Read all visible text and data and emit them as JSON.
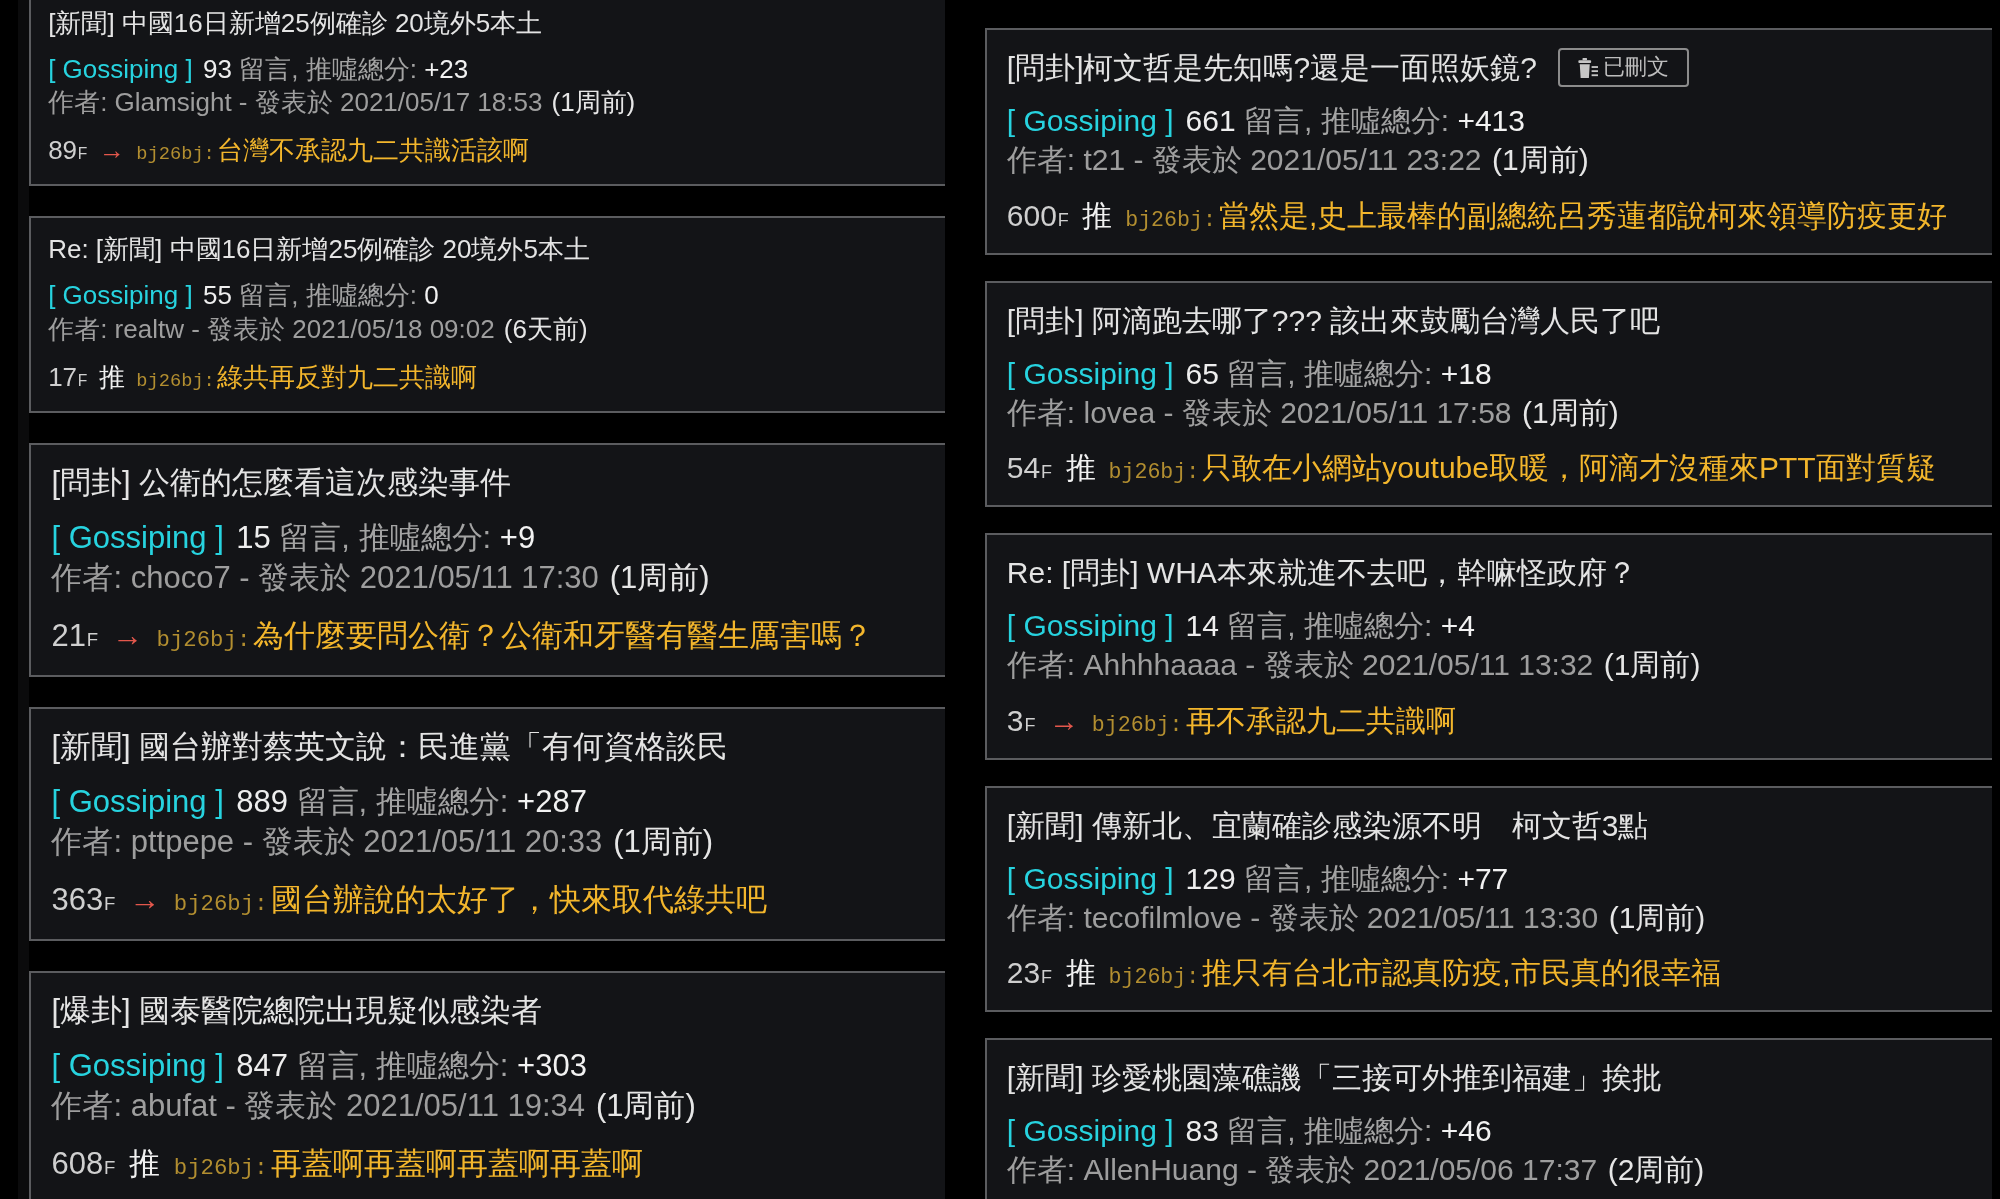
{
  "columns": [
    {
      "posts": [
        {
          "title": "[新聞] 中國16日新增25例確診 20境外5本土",
          "board": "[ Gossiping ]",
          "comments": "93",
          "stats_label": "留言, 推噓總分:",
          "score": "+23",
          "author_line": "作者: Glamsight - 發表於 2021/05/17 18:53",
          "age": "(1周前)",
          "top_comment": {
            "floor": "89",
            "floor_suffix": "F",
            "kind": "arrow",
            "tag": "→",
            "user": "bj26bj:",
            "text": "台灣不承認九二共識活該啊"
          }
        },
        {
          "title": "Re: [新聞] 中國16日新增25例確診 20境外5本土",
          "board": "[ Gossiping ]",
          "comments": "55",
          "stats_label": "留言, 推噓總分:",
          "score": "0",
          "author_line": "作者: realtw - 發表於 2021/05/18 09:02",
          "age": "(6天前)",
          "top_comment": {
            "floor": "17",
            "floor_suffix": "F",
            "kind": "push",
            "tag": "推",
            "user": "bj26bj:",
            "text": "綠共再反對九二共識啊"
          }
        },
        {
          "title": "[問卦] 公衛的怎麼看這次感染事件",
          "board": "[ Gossiping ]",
          "comments": "15",
          "stats_label": "留言, 推噓總分:",
          "score": "+9",
          "author_line": "作者: choco7 - 發表於 2021/05/11 17:30",
          "age": "(1周前)",
          "top_comment": {
            "floor": "21",
            "floor_suffix": "F",
            "kind": "arrow",
            "tag": "→",
            "user": "bj26bj:",
            "text": "為什麼要問公衛？公衛和牙醫有醫生厲害嗎？"
          }
        },
        {
          "title": "[新聞] 國台辦對蔡英文說：民進黨「有何資格談民",
          "board": "[ Gossiping ]",
          "comments": "889",
          "stats_label": "留言, 推噓總分:",
          "score": "+287",
          "author_line": "作者: pttpepe - 發表於 2021/05/11 20:33",
          "age": "(1周前)",
          "top_comment": {
            "floor": "363",
            "floor_suffix": "F",
            "kind": "arrow",
            "tag": "→",
            "user": "bj26bj:",
            "text": "國台辦說的太好了，快來取代綠共吧"
          }
        },
        {
          "title": "[爆卦] 國泰醫院總院出現疑似感染者",
          "board": "[ Gossiping ]",
          "comments": "847",
          "stats_label": "留言, 推噓總分:",
          "score": "+303",
          "author_line": "作者: abufat - 發表於 2021/05/11 19:34",
          "age": "(1周前)",
          "top_comment": {
            "floor": "608",
            "floor_suffix": "F",
            "kind": "push",
            "tag": "推",
            "user": "bj26bj:",
            "text": "再蓋啊再蓋啊再蓋啊再蓋啊"
          }
        }
      ]
    },
    {
      "posts": [
        {
          "title": "[問卦]柯文哲是先知嗎?還是一面照妖鏡?",
          "badge": "已刪文",
          "board": "[ Gossiping ]",
          "comments": "661",
          "stats_label": "留言, 推噓總分:",
          "score": "+413",
          "author_line": "作者: t21 - 發表於 2021/05/11 23:22",
          "age": "(1周前)",
          "top_comment": {
            "floor": "600",
            "floor_suffix": "F",
            "kind": "push",
            "tag": "推",
            "user": "bj26bj:",
            "text": "當然是,史上最棒的副總統呂秀蓮都說柯來領導防疫更好"
          }
        },
        {
          "title": "[問卦] 阿滴跑去哪了??? 該出來鼓勵台灣人民了吧",
          "board": "[ Gossiping ]",
          "comments": "65",
          "stats_label": "留言, 推噓總分:",
          "score": "+18",
          "author_line": "作者: lovea - 發表於 2021/05/11 17:58",
          "age": "(1周前)",
          "top_comment": {
            "floor": "54",
            "floor_suffix": "F",
            "kind": "push",
            "tag": "推",
            "user": "bj26bj:",
            "text": "只敢在小網站youtube取暖，阿滴才沒種來PTT面對質疑"
          }
        },
        {
          "title": "Re: [問卦] WHA本來就進不去吧，幹嘛怪政府？",
          "board": "[ Gossiping ]",
          "comments": "14",
          "stats_label": "留言, 推噓總分:",
          "score": "+4",
          "author_line": "作者: Ahhhhaaaa - 發表於 2021/05/11 13:32",
          "age": "(1周前)",
          "top_comment": {
            "floor": "3",
            "floor_suffix": "F",
            "kind": "arrow",
            "tag": "→",
            "user": "bj26bj:",
            "text": "再不承認九二共識啊"
          }
        },
        {
          "title": "[新聞] 傳新北、宜蘭確診感染源不明　柯文哲3點",
          "board": "[ Gossiping ]",
          "comments": "129",
          "stats_label": "留言, 推噓總分:",
          "score": "+77",
          "author_line": "作者: tecofilmlove - 發表於 2021/05/11 13:30",
          "age": "(1周前)",
          "top_comment": {
            "floor": "23",
            "floor_suffix": "F",
            "kind": "push",
            "tag": "推",
            "user": "bj26bj:",
            "text": "推只有台北市認真防疫,市民真的很幸福"
          }
        },
        {
          "title": "[新聞] 珍愛桃園藻礁譏「三接可外推到福建」挨批",
          "board": "[ Gossiping ]",
          "comments": "83",
          "stats_label": "留言, 推噓總分:",
          "score": "+46",
          "author_line": "作者: AllenHuang - 發表於 2021/05/06 17:37",
          "age": "(2周前)"
        }
      ]
    }
  ]
}
